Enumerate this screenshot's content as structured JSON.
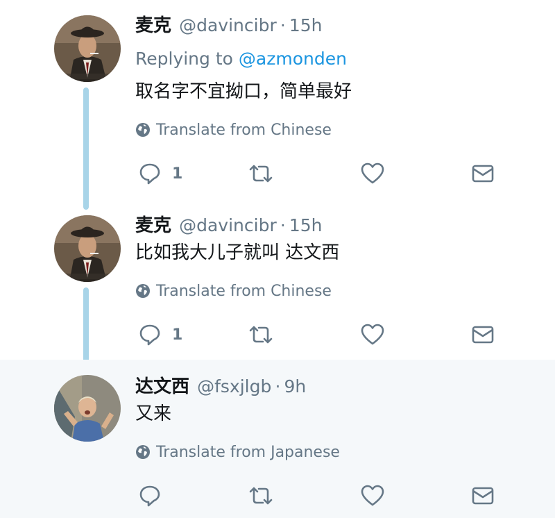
{
  "colors": {
    "accent": "#1b95e0",
    "thread_line": "#a8d4e8",
    "muted": "#657786",
    "highlight_bg": "#f5f8fa"
  },
  "tweets": [
    {
      "name": "麦克",
      "handle": "@davincibr",
      "separator": "·",
      "time": "15h",
      "replying_prefix": "Replying to",
      "replying_to": "@azmonden",
      "text": "取名字不宜拗口，简单最好",
      "translate": "Translate from Chinese",
      "reply_count": "1",
      "icons": [
        "reply-icon",
        "retweet-icon",
        "like-icon",
        "dm-icon"
      ]
    },
    {
      "name": "麦克",
      "handle": "@davincibr",
      "separator": "·",
      "time": "15h",
      "text": "比如我大儿子就叫 达文西",
      "translate": "Translate from Chinese",
      "reply_count": "1",
      "icons": [
        "reply-icon",
        "retweet-icon",
        "like-icon",
        "dm-icon"
      ]
    },
    {
      "name": "达文西",
      "handle": "@fsxjlgb",
      "separator": "·",
      "time": "9h",
      "text": "又来",
      "translate": "Translate from Japanese",
      "reply_count": "",
      "icons": [
        "reply-icon",
        "retweet-icon",
        "like-icon",
        "dm-icon"
      ]
    }
  ]
}
